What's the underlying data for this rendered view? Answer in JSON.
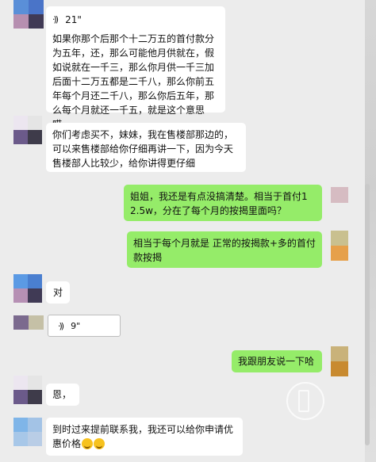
{
  "messages": [
    {
      "duration": "21\"",
      "text": "如果你那个后那个十二万五的首付款分为五年，还，那么可能他月供就在，假如说就在一千三，那么你月供一千三加后面十二万五都是二千八，那么你前五年每个月还二千八，那么你后五年，那么每个月就还一千五，就是这个意思哎。"
    },
    {
      "text": "你们考虑买不，妹妹，我在售楼部那边的，可以来售楼部给你仔细再讲一下，因为今天售楼部人比较少，给你讲得更仔细"
    },
    {
      "text": "姐姐，我还是有点没搞清楚。相当于首付12.5w，分在了每个月的按揭里面吗？"
    },
    {
      "text": "相当于每个月就是 正常的按揭款+多的首付款按揭"
    },
    {
      "text": "对"
    },
    {
      "duration": "9\""
    },
    {
      "text": "我跟朋友说一下哈"
    },
    {
      "text": "恩，"
    },
    {
      "text": "到时过来提前联系我，我还可以给你申请优惠价格"
    }
  ],
  "icons": {
    "voice": "voice-wave-icon",
    "emoji": "embarrassed-smile-emoji"
  },
  "colors": {
    "background": "#ececec",
    "incoming_bubble": "#ffffff",
    "outgoing_bubble": "#95ec69",
    "avatar_blue": "#4a8fe0",
    "avatar_purple": "#7a5a90",
    "avatar_pink": "#d7b8c2",
    "avatar_olive": "#bdb58a",
    "avatar_orange": "#e0a040"
  }
}
